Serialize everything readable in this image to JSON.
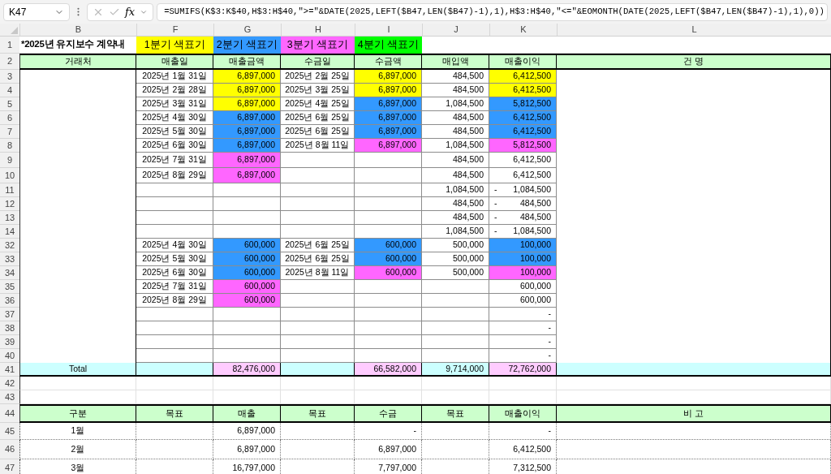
{
  "formula_bar": {
    "name_box": "K47",
    "function_button": "fx",
    "formula": "=SUMIFS(K$3:K$40,H$3:H$40,\">=\"&DATE(2025,LEFT($B47,LEN($B47)-1),1),H$3:H$40,\"<=\"&EOMONTH(DATE(2025,LEFT($B47,LEN($B47)-1),1),0))"
  },
  "columns": [
    "B",
    "F",
    "G",
    "H",
    "I",
    "J",
    "K",
    "L"
  ],
  "rows": [
    {
      "number": "1",
      "kind": "title",
      "cells": [
        {
          "text": "*2025년 유지보수 계약내"
        },
        {
          "text": "1분기 색표기",
          "color": "#ffff00"
        },
        {
          "text": "2분기 색표기",
          "color": "#3399ff"
        },
        {
          "text": "3분기 색표기",
          "color": "#ff66ff"
        },
        {
          "text": "4분기 색표기",
          "color": "#00ff00"
        },
        null,
        null,
        null
      ]
    },
    {
      "number": "2",
      "kind": "header",
      "cells": [
        "거래처",
        "매출일",
        "매출금액",
        "수금일",
        "수금액",
        "매입액",
        "매출이익",
        "건 명"
      ]
    },
    {
      "number": "3",
      "kind": "data",
      "cells": [
        null,
        "2025년 1월 31일",
        {
          "text": "6,897,000",
          "color": "#ffff00"
        },
        "2025년 2월 25일",
        {
          "text": "6,897,000",
          "color": "#ffff00"
        },
        "484,500",
        {
          "text": "6,412,500",
          "color": "#ffff00"
        },
        null
      ]
    },
    {
      "number": "4",
      "kind": "data",
      "cells": [
        null,
        "2025년 2월 28일",
        {
          "text": "6,897,000",
          "color": "#ffff00"
        },
        "2025년 3월 25일",
        {
          "text": "6,897,000",
          "color": "#ffff00"
        },
        "484,500",
        {
          "text": "6,412,500",
          "color": "#ffff00"
        },
        null
      ]
    },
    {
      "number": "5",
      "kind": "data",
      "cells": [
        null,
        "2025년 3월 31일",
        {
          "text": "6,897,000",
          "color": "#ffff00"
        },
        "2025년 4월 25일",
        {
          "text": "6,897,000",
          "color": "#3399ff"
        },
        "1,084,500",
        {
          "text": "5,812,500",
          "color": "#3399ff"
        },
        null
      ]
    },
    {
      "number": "6",
      "kind": "data",
      "cells": [
        null,
        "2025년 4월 30일",
        {
          "text": "6,897,000",
          "color": "#3399ff"
        },
        "2025년 6월 25일",
        {
          "text": "6,897,000",
          "color": "#3399ff"
        },
        "484,500",
        {
          "text": "6,412,500",
          "color": "#3399ff"
        },
        null
      ]
    },
    {
      "number": "7",
      "kind": "data",
      "cells": [
        null,
        "2025년 5월 30일",
        {
          "text": "6,897,000",
          "color": "#3399ff"
        },
        "2025년 6월 25일",
        {
          "text": "6,897,000",
          "color": "#3399ff"
        },
        "484,500",
        {
          "text": "6,412,500",
          "color": "#3399ff"
        },
        null
      ]
    },
    {
      "number": "8",
      "kind": "data",
      "cells": [
        null,
        "2025년 6월 30일",
        {
          "text": "6,897,000",
          "color": "#3399ff"
        },
        "2025년 8월 11일",
        {
          "text": "6,897,000",
          "color": "#ff66ff"
        },
        "1,084,500",
        {
          "text": "5,812,500",
          "color": "#ff66ff"
        },
        null
      ]
    },
    {
      "number": "9",
      "kind": "data",
      "cells": [
        null,
        "2025년 7월 31일",
        {
          "text": "6,897,000",
          "color": "#ff66ff"
        },
        null,
        null,
        "484,500",
        "6,412,500",
        null
      ]
    },
    {
      "number": "10",
      "kind": "data",
      "cells": [
        null,
        "2025년 8월 29일",
        {
          "text": "6,897,000",
          "color": "#ff66ff"
        },
        null,
        null,
        "484,500",
        "6,412,500",
        null
      ]
    },
    {
      "number": "11",
      "kind": "data",
      "cells": [
        null,
        null,
        null,
        null,
        null,
        "1,084,500",
        {
          "sign": "-",
          "text": "1,084,500"
        },
        null
      ]
    },
    {
      "number": "12",
      "kind": "data",
      "cells": [
        null,
        null,
        null,
        null,
        null,
        "484,500",
        {
          "sign": "-",
          "text": "484,500"
        },
        null
      ]
    },
    {
      "number": "13",
      "kind": "data",
      "cells": [
        null,
        null,
        null,
        null,
        null,
        "484,500",
        {
          "sign": "-",
          "text": "484,500"
        },
        null
      ]
    },
    {
      "number": "14",
      "kind": "data",
      "cells": [
        null,
        null,
        null,
        null,
        null,
        "1,084,500",
        {
          "sign": "-",
          "text": "1,084,500"
        },
        null
      ]
    },
    {
      "number": "32",
      "kind": "data",
      "cells": [
        null,
        "2025년 4월 30일",
        {
          "text": "600,000",
          "color": "#3399ff"
        },
        "2025년 6월 25일",
        {
          "text": "600,000",
          "color": "#3399ff"
        },
        "500,000",
        {
          "text": "100,000",
          "color": "#3399ff"
        },
        null
      ]
    },
    {
      "number": "33",
      "kind": "data",
      "cells": [
        null,
        "2025년 5월 30일",
        {
          "text": "600,000",
          "color": "#3399ff"
        },
        "2025년 6월 25일",
        {
          "text": "600,000",
          "color": "#3399ff"
        },
        "500,000",
        {
          "text": "100,000",
          "color": "#3399ff"
        },
        null
      ]
    },
    {
      "number": "34",
      "kind": "data",
      "cells": [
        null,
        "2025년 6월 30일",
        {
          "text": "600,000",
          "color": "#3399ff"
        },
        "2025년 8월 11일",
        {
          "text": "600,000",
          "color": "#ff66ff"
        },
        "500,000",
        {
          "text": "100,000",
          "color": "#ff66ff"
        },
        null
      ]
    },
    {
      "number": "35",
      "kind": "data",
      "cells": [
        null,
        "2025년 7월 31일",
        {
          "text": "600,000",
          "color": "#ff66ff"
        },
        null,
        null,
        null,
        "600,000",
        null
      ]
    },
    {
      "number": "36",
      "kind": "data",
      "cells": [
        null,
        "2025년 8월 29일",
        {
          "text": "600,000",
          "color": "#ff66ff"
        },
        null,
        null,
        null,
        "600,000",
        null
      ]
    },
    {
      "number": "37",
      "kind": "data",
      "cells": [
        null,
        null,
        null,
        null,
        null,
        null,
        "-",
        null
      ]
    },
    {
      "number": "38",
      "kind": "data",
      "cells": [
        null,
        null,
        null,
        null,
        null,
        null,
        "-",
        null
      ]
    },
    {
      "number": "39",
      "kind": "data",
      "cells": [
        null,
        null,
        null,
        null,
        null,
        null,
        "-",
        null
      ]
    },
    {
      "number": "40",
      "kind": "data",
      "cells": [
        null,
        null,
        null,
        null,
        null,
        null,
        "-",
        null
      ]
    },
    {
      "number": "41",
      "kind": "total",
      "cells": [
        {
          "text": "Total",
          "color": "#ccffff"
        },
        {
          "color": "#ccffff"
        },
        {
          "text": "82,476,000",
          "color": "#ffccff"
        },
        {
          "color": "#ccffff"
        },
        {
          "text": "66,582,000",
          "color": "#ffccff"
        },
        {
          "text": "9,714,000",
          "color": "#ccffff"
        },
        {
          "text": "72,762,000",
          "color": "#ffccff"
        },
        {
          "color": "#ccffff"
        }
      ]
    },
    {
      "number": "42",
      "kind": "blank",
      "cells": [
        null,
        null,
        null,
        null,
        null,
        null,
        null,
        null
      ]
    },
    {
      "number": "43",
      "kind": "blank",
      "cells": [
        null,
        null,
        null,
        null,
        null,
        null,
        null,
        null
      ]
    },
    {
      "number": "44",
      "kind": "header",
      "cells": [
        "구분",
        "목표",
        "매출",
        "목표",
        "수금",
        "목표",
        "매출이익",
        "비 고"
      ]
    },
    {
      "number": "45",
      "kind": "summary",
      "cells": [
        "1월",
        null,
        "6,897,000",
        null,
        "-",
        null,
        "-",
        null
      ]
    },
    {
      "number": "46",
      "kind": "summary",
      "cells": [
        "2월",
        null,
        "6,897,000",
        null,
        "6,897,000",
        null,
        "6,412,500",
        null
      ]
    },
    {
      "number": "47",
      "kind": "summary",
      "cells": [
        "3월",
        null,
        "16,797,000",
        null,
        "7,797,000",
        null,
        "7,312,500",
        null
      ]
    }
  ]
}
